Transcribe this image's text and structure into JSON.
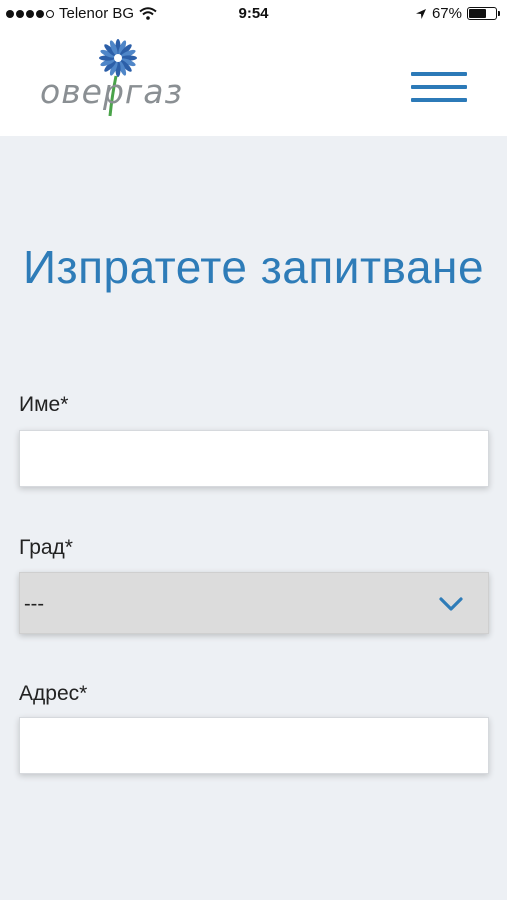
{
  "status_bar": {
    "carrier": "Telenor BG",
    "time": "9:54",
    "battery_percent": "67%",
    "battery_level": 0.67,
    "signal_icons": [
      "signal-dots-icon",
      "wifi-icon",
      "location-arrow-icon",
      "battery-icon"
    ]
  },
  "header": {
    "logo_text": "овергаз",
    "menu_icon": "hamburger-icon"
  },
  "form": {
    "title": "Изпратете запитване",
    "name_label": "Име*",
    "name_value": "",
    "city_label": "Град*",
    "city_selected": "---",
    "address_label": "Адрес*",
    "address_value": ""
  },
  "colors": {
    "accent": "#2e7cb8",
    "background": "#edf0f4",
    "logo_flower": "#2c5fa8",
    "logo_stem": "#4aa34a"
  }
}
